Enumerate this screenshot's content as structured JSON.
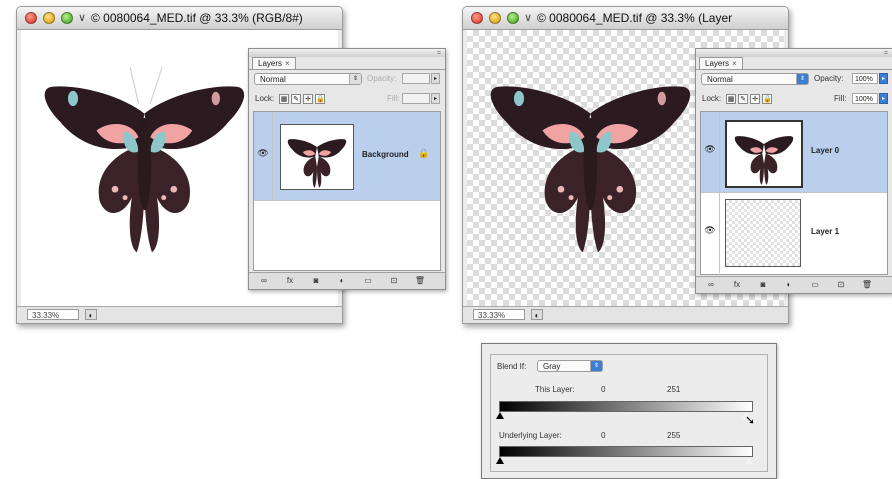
{
  "left_window": {
    "title": "© 0080064_MED.tif @ 33.3% (RGB/8#)",
    "zoom": "33.33%",
    "layers_panel": {
      "tab_label": "Layers",
      "blend_mode": "Normal",
      "opacity_label": "Opacity:",
      "opacity_value": "",
      "lock_label": "Lock:",
      "fill_label": "Fill:",
      "fill_value": "",
      "layers": [
        {
          "name": "Background",
          "selected": true,
          "locked": true,
          "thumbnail": "butterfly"
        }
      ]
    }
  },
  "right_window": {
    "title": "© 0080064_MED.tif @ 33.3% (Layer",
    "zoom": "33.33%",
    "layers_panel": {
      "tab_label": "Layers",
      "blend_mode": "Normal",
      "opacity_label": "Opacity:",
      "opacity_value": "100%",
      "lock_label": "Lock:",
      "fill_label": "Fill:",
      "fill_value": "100%",
      "layers": [
        {
          "name": "Layer 0",
          "selected": true,
          "locked": false,
          "thumbnail": "butterfly"
        },
        {
          "name": "Layer 1",
          "selected": false,
          "locked": false,
          "thumbnail": "transparent"
        }
      ]
    }
  },
  "blend_if": {
    "label": "Blend If:",
    "channel": "Gray",
    "this_layer_label": "This Layer:",
    "this_layer_black": "0",
    "this_layer_white": "251",
    "underlying_label": "Underlying Layer:",
    "underlying_black": "0",
    "underlying_white": "255"
  },
  "icons": {
    "eye": "eye-icon",
    "lock": "lock-icon",
    "link": "link-icon",
    "fx": "fx-icon",
    "mask": "mask-icon",
    "adjustment": "adjustment-icon",
    "group": "folder-icon",
    "new_layer": "new-layer-icon",
    "trash": "trash-icon",
    "cursor": "pointer-cursor-icon"
  },
  "colors": {
    "selection_blue": "#b9cfeb",
    "accent_blue": "#3b7ed6"
  }
}
